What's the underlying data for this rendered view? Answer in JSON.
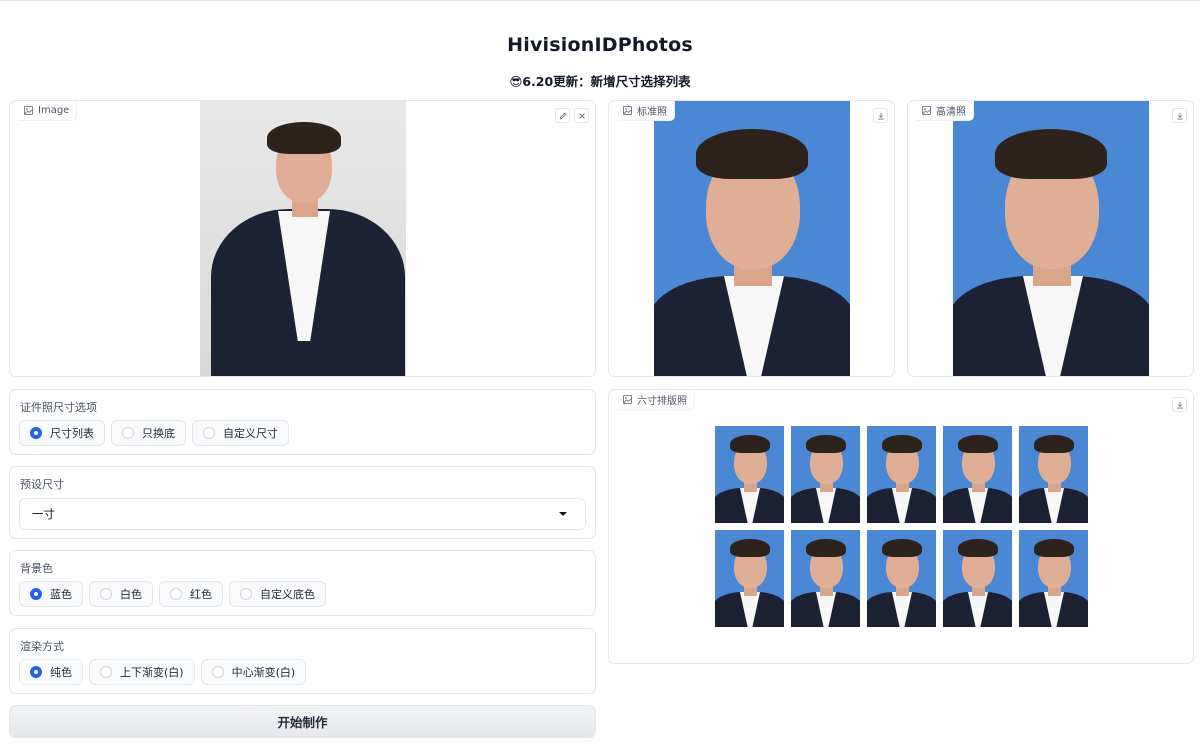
{
  "app": {
    "title": "HivisionIDPhotos",
    "subtitle": "😎6.20更新：新增尺寸选择列表"
  },
  "input_image": {
    "label": "Image",
    "actions": [
      "edit-icon",
      "close-icon"
    ]
  },
  "standard_photo": {
    "label": "标准照",
    "action": "download-icon"
  },
  "hd_photo": {
    "label": "高清照",
    "action": "download-icon"
  },
  "layout_photo": {
    "label": "六寸排版照",
    "action": "download-icon",
    "count": 10
  },
  "size_options": {
    "label": "证件照尺寸选项",
    "options": [
      "尺寸列表",
      "只换底",
      "自定义尺寸"
    ],
    "selected": "尺寸列表"
  },
  "preset_size": {
    "label": "预设尺寸",
    "value": "一寸"
  },
  "background": {
    "label": "背景色",
    "options": [
      "蓝色",
      "白色",
      "红色",
      "自定义底色"
    ],
    "selected": "蓝色"
  },
  "render_mode": {
    "label": "渲染方式",
    "options": [
      "纯色",
      "上下渐变(白)",
      "中心渐变(白)"
    ],
    "selected": "纯色"
  },
  "submit": {
    "label": "开始制作"
  },
  "colors": {
    "accent": "#2563eb",
    "photo_background_blue": "#4a87d4",
    "border": "#e5e7eb"
  }
}
